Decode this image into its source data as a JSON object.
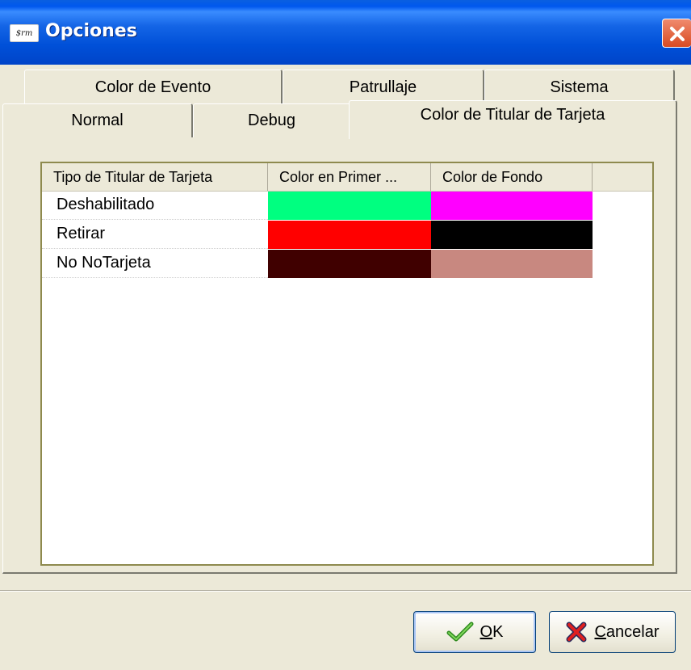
{
  "window": {
    "title": "Opciones",
    "icon_text": "$rm"
  },
  "tabs": {
    "row1": [
      "Color de Evento",
      "Patrullaje",
      "Sistema"
    ],
    "row2": [
      "Normal",
      "Debug",
      "Color de Titular de Tarjeta"
    ],
    "active": "Color de Titular de Tarjeta"
  },
  "list": {
    "columns": [
      "Tipo de Titular de Tarjeta",
      "Color en Primer ...",
      "Color de Fondo"
    ],
    "rows": [
      {
        "name": "Deshabilitado",
        "fg_color": "#00ff80",
        "bg_color": "#ff00ff"
      },
      {
        "name": "Retirar",
        "fg_color": "#ff0000",
        "bg_color": "#000000"
      },
      {
        "name": "No NoTarjeta",
        "fg_color": "#400000",
        "bg_color": "#c88880"
      }
    ]
  },
  "buttons": {
    "ok": {
      "accel": "O",
      "rest": "K",
      "icon": "checkmark-icon"
    },
    "cancel": {
      "accel": "C",
      "rest": "ancelar",
      "icon": "x-icon"
    }
  },
  "colors": {
    "titlebar": "#0050d8",
    "dialog_bg": "#ece9d8",
    "close_button": "#d84b22"
  }
}
